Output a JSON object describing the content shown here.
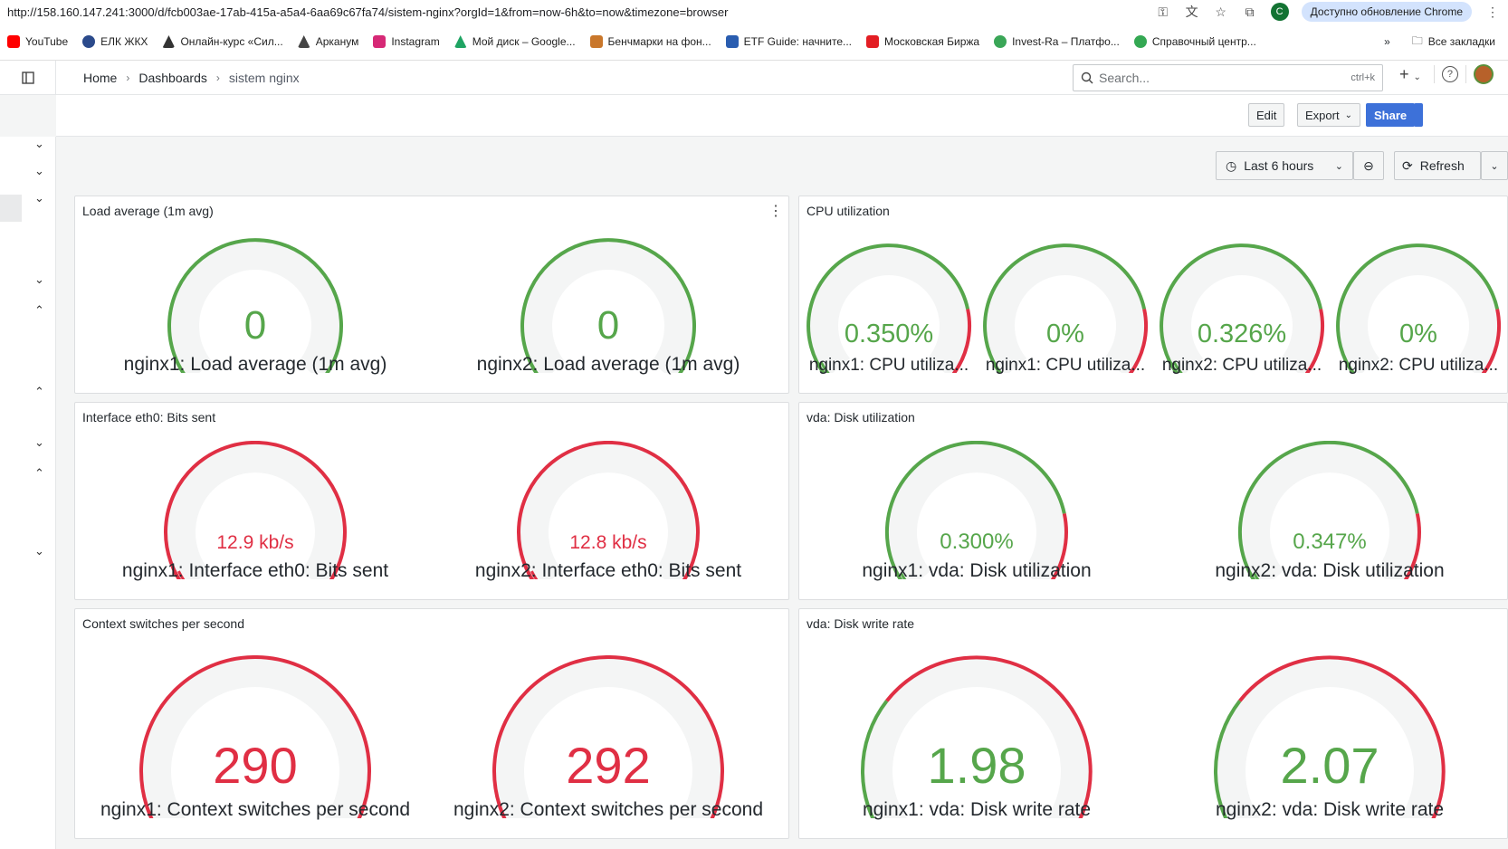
{
  "browser": {
    "url": "http://158.160.147.241:3000/d/fcb003ae-17ab-415a-a5a4-6aa69c67fa74/sistem-nginx?orgId=1&from=now-6h&to=now&timezone=browser",
    "profile_initial": "C",
    "update_text": "Доступно обновление Chrome",
    "bookmarks": [
      "YouTube",
      "ЕЛК ЖКХ",
      "Онлайн-курс «Сил...",
      "Арканум",
      "Instagram",
      "Мой диск – Google...",
      "Бенчмарки на фон...",
      "ETF Guide: начните...",
      "Московская Биржа",
      "Invest-Ra – Платфо...",
      "Справочный центр..."
    ],
    "all_bookmarks": "Все закладки"
  },
  "header": {
    "breadcrumbs": [
      "Home",
      "Dashboards",
      "sistem nginx"
    ],
    "search_placeholder": "Search...",
    "search_shortcut": "ctrl+k"
  },
  "toolbar": {
    "edit": "Edit",
    "export": "Export",
    "share": "Share",
    "time_range": "Last 6 hours",
    "refresh": "Refresh"
  },
  "colors": {
    "green": "#56a64b",
    "red": "#e02f44",
    "track": "#f4f5f5",
    "blue": "#3d71d9"
  },
  "panels": [
    {
      "title": "Load average (1m avg)",
      "gauges": [
        {
          "value": "0",
          "label": "nginx1: Load average (1m avg)",
          "fill": 0,
          "color": "green",
          "threshold": null
        },
        {
          "value": "0",
          "label": "nginx2: Load average (1m avg)",
          "fill": 0,
          "color": "green",
          "threshold": null
        }
      ]
    },
    {
      "title": "CPU utilization",
      "gauges": [
        {
          "value": "0.350%",
          "label": "nginx1: CPU utiliza...",
          "fill": 0.0035,
          "color": "green",
          "threshold": 0.8
        },
        {
          "value": "0%",
          "label": "nginx1: CPU utiliza...",
          "fill": 0,
          "color": "green",
          "threshold": 0.8
        },
        {
          "value": "0.326%",
          "label": "nginx2: CPU utiliza...",
          "fill": 0.00326,
          "color": "green",
          "threshold": 0.8
        },
        {
          "value": "0%",
          "label": "nginx2: CPU utiliza...",
          "fill": 0,
          "color": "green",
          "threshold": 0.8
        }
      ]
    },
    {
      "title": "Interface eth0: Bits sent",
      "gauges": [
        {
          "value": "12.9 kb/s",
          "label": "nginx1: Interface eth0: Bits sent",
          "fill": 0.05,
          "color": "red",
          "threshold": 0
        },
        {
          "value": "12.8 kb/s",
          "label": "nginx2: Interface eth0: Bits sent",
          "fill": 0.05,
          "color": "red",
          "threshold": 0
        }
      ]
    },
    {
      "title": "vda: Disk utilization",
      "gauges": [
        {
          "value": "0.300%",
          "label": "nginx1: vda: Disk utilization",
          "fill": 0.003,
          "color": "green",
          "threshold": 0.8
        },
        {
          "value": "0.347%",
          "label": "nginx2: vda: Disk utilization",
          "fill": 0.00347,
          "color": "green",
          "threshold": 0.8
        }
      ]
    },
    {
      "title": "Context switches per second",
      "gauges": [
        {
          "value": "290",
          "label": "nginx1: Context switches per second",
          "fill": 0.05,
          "color": "red",
          "threshold": 0
        },
        {
          "value": "292",
          "label": "nginx2: Context switches per second",
          "fill": 0.05,
          "color": "red",
          "threshold": 0
        }
      ]
    },
    {
      "title": "vda: Disk write rate",
      "gauges": [
        {
          "value": "1.98",
          "label": "nginx1: vda: Disk write rate",
          "fill": 0.05,
          "color": "green",
          "threshold": 0.3
        },
        {
          "value": "2.07",
          "label": "nginx2: vda: Disk write rate",
          "fill": 0.05,
          "color": "green",
          "threshold": 0.3
        }
      ]
    }
  ]
}
